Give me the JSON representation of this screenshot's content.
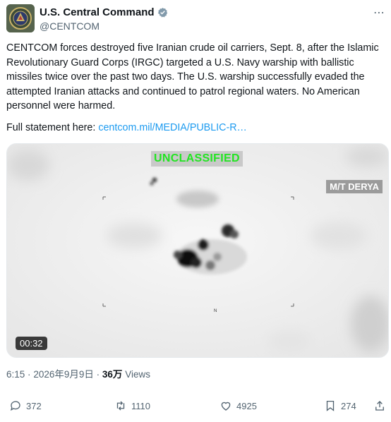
{
  "account": {
    "display_name": "U.S. Central Command",
    "handle": "@CENTCOM"
  },
  "tweet": {
    "text": "CENTCOM forces destroyed five Iranian crude oil carriers, Sept. 8, after the Islamic Revolutionary Guard Corps (IRGC) targeted a U.S. Navy warship with ballistic missiles twice over the past two days. The U.S. warship successfully evaded the attempted Iranian attacks and continued to patrol regional waters. No American personnel were harmed.",
    "statement_prefix": "Full statement here: ",
    "statement_link": "centcom.mil/MEDIA/PUBLIC-R…"
  },
  "media": {
    "classification": "UNCLASSIFIED",
    "vessel_label": "M/T DERYA",
    "north_marker": "N",
    "duration": "00:32"
  },
  "meta": {
    "time": "6:15",
    "separator": "·",
    "date": "2026年9月9日",
    "views_count": "36万",
    "views_label": "Views"
  },
  "actions": {
    "replies": "372",
    "reposts": "1110",
    "likes": "4925",
    "bookmarks": "274"
  },
  "colors": {
    "link": "#1d9bf0",
    "classification_text": "#22e522",
    "muted": "#536471"
  }
}
